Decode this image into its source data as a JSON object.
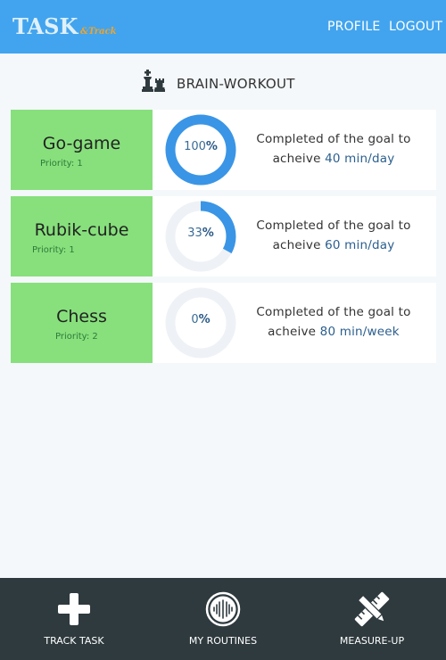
{
  "header": {
    "logo_main": "TASK",
    "logo_sub": "&Track",
    "nav": {
      "profile": "PROFILE",
      "logout": "LOGOUT"
    }
  },
  "section": {
    "title": "BRAIN-WORKOUT",
    "icon": "chess-pieces-icon"
  },
  "tasks": [
    {
      "name": "Go-game",
      "priority": "Priority: 1",
      "percent": 100,
      "percent_label": "100",
      "pct_sign": "%",
      "goal_prefix": "Completed of the goal to acheive",
      "goal_target": "40 min/day"
    },
    {
      "name": "Rubik-cube",
      "priority": "Priority: 1",
      "percent": 33,
      "percent_label": "33",
      "pct_sign": "%",
      "goal_prefix": "Completed of the goal to acheive",
      "goal_target": "60 min/day"
    },
    {
      "name": "Chess",
      "priority": "Priority: 2",
      "percent": 0,
      "percent_label": "0",
      "pct_sign": "%",
      "goal_prefix": "Completed of the goal to acheive",
      "goal_target": "80 min/week"
    }
  ],
  "footer": {
    "items": [
      {
        "label": "TRACK TASK",
        "icon": "plus-icon"
      },
      {
        "label": "MY ROUTINES",
        "icon": "routines-icon"
      },
      {
        "label": "MEASURE-UP",
        "icon": "ruler-pencil-icon"
      }
    ]
  },
  "colors": {
    "header": "#42a4ee",
    "task_name_bg": "#87e07c",
    "ring_fill": "#3a95e6",
    "ring_track": "#eef2f6",
    "footer": "#2f3a3f"
  }
}
